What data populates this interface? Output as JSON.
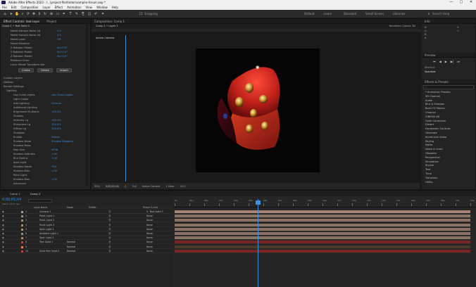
{
  "window": {
    "title": "Adobe After Effects 2023 - \\...\\project-file\\folder\\vampire-forum.aep *",
    "controls": [
      "—",
      "▢",
      "✕"
    ]
  },
  "menu": [
    "File",
    "Edit",
    "Composition",
    "Layer",
    "Effect",
    "Animation",
    "View",
    "Window",
    "Help"
  ],
  "toolbar": {
    "workspaces": [
      "Default",
      "Learn",
      "Standard",
      "Small Screen",
      "Libraries"
    ],
    "search_placeholder": "Search Help",
    "snapping": "Snapping"
  },
  "left_panel": {
    "tabs": [
      "Effect Controls: text-layer",
      "Project"
    ],
    "breadcrumb": "Comp 1 • Text Solid 2",
    "rows_top": [
      {
        "label": "Model Sample Noise 2d",
        "value": "0.0"
      },
      {
        "label": "Model Sample Noise 3d",
        "value": "0.0"
      },
      {
        "label": "Model Load",
        "value": "Off"
      },
      {
        "label": "Model Rotation",
        "value": ""
      },
      {
        "label": "X Rotation Model",
        "value": "0x+0.0°"
      },
      {
        "label": "Y Rotation Model",
        "value": "0x+0.0°"
      },
      {
        "label": "Z Rotation Model",
        "value": "0x+0.0°"
      },
      {
        "label": "Rotation Order",
        "value": ""
      },
      {
        "label": "Layer Model Transform Attr.",
        "value": ""
      }
    ],
    "buttons": [
      "Create",
      "Delete",
      "Import"
    ],
    "sections": [
      "Custom Layers",
      "Utilities",
      "Render Settings",
      "Lighting"
    ],
    "lighting_rows": [
      {
        "label": "Use Comp Lights",
        "value": "Use Comp Lights"
      },
      {
        "label": "Light Colour",
        "value": ""
      },
      {
        "label": "Add Lighting",
        "value": "Chrome"
      },
      {
        "label": "Additional Lighting",
        "value": ""
      },
      {
        "label": "Brightness Multiplier",
        "value": "100.0%"
      },
      {
        "label": "Shadow",
        "value": ""
      },
      {
        "label": "Intensity Lg",
        "value": "100.0%"
      },
      {
        "label": "Sharpness Lg",
        "value": "100.0%"
      },
      {
        "label": "Diffuse Lg",
        "value": "100.0%"
      },
      {
        "label": "Shadows",
        "value": ""
      },
      {
        "label": "Enable",
        "value": "Visible"
      },
      {
        "label": "Shadow Mode",
        "value": "Shadow Mapping"
      },
      {
        "label": "Shadow Maps",
        "value": ""
      },
      {
        "label": "Map Size",
        "value": "4096"
      },
      {
        "label": "Shadow Softness",
        "value": "1.00"
      },
      {
        "label": "Blur Radius",
        "value": "1.00"
      },
      {
        "label": "Spot Light",
        "value": ""
      },
      {
        "label": "Shadow Depth",
        "value": "100"
      },
      {
        "label": "Shadow Bias",
        "value": "1.00"
      },
      {
        "label": "Point Light",
        "value": ""
      },
      {
        "label": "Shadow Bias",
        "value": "1.00"
      },
      {
        "label": "Advanced",
        "value": ""
      }
    ]
  },
  "comp_panel": {
    "tab": "Composition: Comp 1",
    "breadcrumb": "Comp 1 • Layer 1",
    "renderer": "Renderer: Classic 3D",
    "camera_label": "Active Camera",
    "footer": {
      "zoom": "50%",
      "time": "0;00;01;04",
      "res": "Full",
      "camera": "Active Camera",
      "views": "1 View",
      "exposure": "+0.0"
    }
  },
  "right_panel": {
    "info_tab": "Info",
    "audio_tab": "Audio",
    "preview_tab": "Preview",
    "shortcut_label": "Shortcut",
    "shortcut_value": "Spacebar",
    "effects_tab": "Effects & Presets",
    "categories": [
      "* Animation Presets",
      "3D Channel",
      "Audio",
      "Blur & Sharpen",
      "Boris FX Mocha",
      "Channel",
      "CINEMA 4D",
      "Color Correction",
      "Distort",
      "Expression Controls",
      "Generate",
      "Immersive Video",
      "Keying",
      "Matte",
      "Noise & Grain",
      "Obsolete",
      "Perspective",
      "Simulation",
      "Stylize",
      "Text",
      "Time",
      "Transition",
      "Utility"
    ]
  },
  "timeline": {
    "tabs": [
      "Comp 1",
      "Comp 2"
    ],
    "timecode": "0;00;01;04",
    "fps": "00034 (29.97 fps)",
    "columns": {
      "name": "Layer Name",
      "mode": "Mode",
      "trk": "TrkMat",
      "parent": "Parent & Link"
    },
    "layers": [
      {
        "num": "1",
        "name": "Camera 1",
        "color": "#b79a8c",
        "mode": "",
        "parent": "3. Text Solid 2"
      },
      {
        "num": "2",
        "name": "Point Light 1",
        "color": "#a68d6a",
        "mode": "",
        "parent": "None"
      },
      {
        "num": "3",
        "name": "Point Light 2",
        "color": "#a68d6a",
        "mode": "",
        "parent": "None"
      },
      {
        "num": "4",
        "name": "Point Light 3",
        "color": "#a68d6a",
        "mode": "",
        "parent": "None"
      },
      {
        "num": "5",
        "name": "Spot Light 1",
        "color": "#a68d6a",
        "mode": "",
        "parent": "None"
      },
      {
        "num": "6",
        "name": "Ambient Light 1",
        "color": "#a68d6a",
        "mode": "",
        "parent": "None"
      },
      {
        "num": "7",
        "name": "Spot Light 2",
        "color": "#a68d6a",
        "mode": "",
        "parent": "None"
      },
      {
        "num": "8",
        "name": "Text Solid 2",
        "color": "#c23a3a",
        "mode": "Normal",
        "parent": "None"
      },
      {
        "num": "9",
        "name": "",
        "color": "#e08a2a",
        "mode": "Normal",
        "parent": "None"
      },
      {
        "num": "10",
        "name": "Dark Red Solid 2",
        "color": "#c23a3a",
        "mode": "Normal",
        "parent": "None"
      }
    ],
    "ruler": [
      "0s",
      "01s",
      "02s",
      "03s",
      "04s",
      "05s",
      "06s",
      "07s",
      "08s",
      "09s",
      "10s",
      "11s",
      "12s",
      "13s",
      "14s",
      "15s",
      "16s",
      "17s",
      "18s",
      "19s",
      "20s"
    ],
    "playhead_fraction": 0.28
  }
}
